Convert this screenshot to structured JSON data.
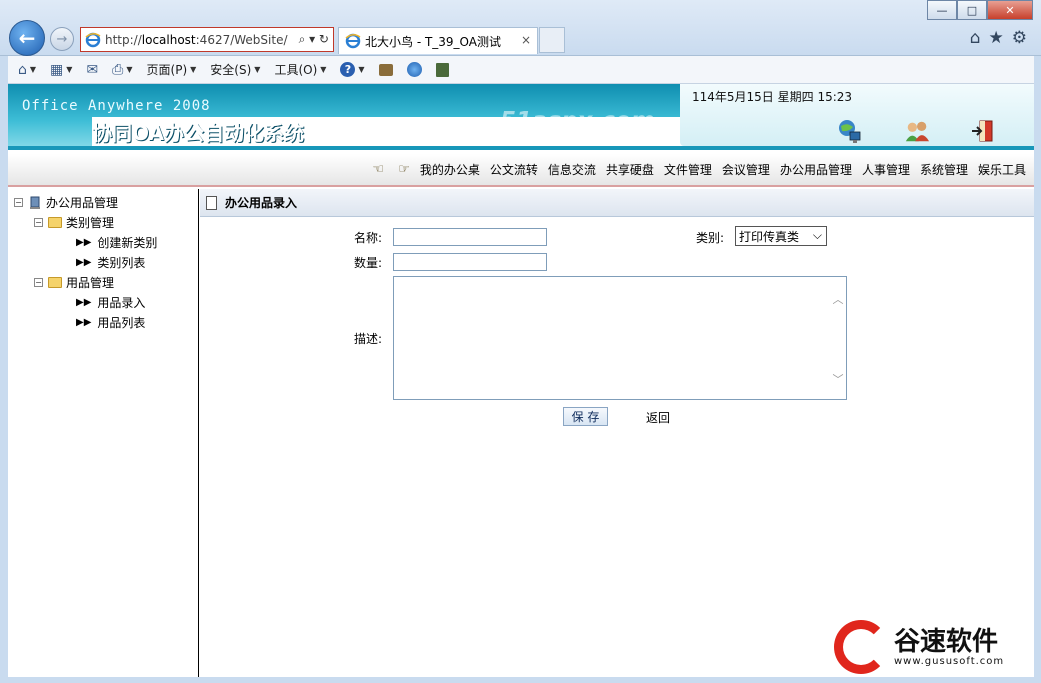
{
  "browser": {
    "address_prefix": "http://",
    "address_host": "localhost",
    "address_rest": ":4627/WebSite/",
    "address_tools": "⌕ ▾ ↻",
    "tab_title": "北大小鸟 - T_39_OA测试",
    "tab_close": "×",
    "back_glyph": "←",
    "forward_glyph": "→",
    "window_buttons": {
      "minimize": "—",
      "maximize": "□",
      "close": "✕"
    },
    "right_icons": {
      "home": "⌂",
      "favorites": "★",
      "tools": "⚙"
    }
  },
  "command_bar": {
    "home_glyph": "⌂",
    "feeds_glyph": "▦",
    "mail_glyph": "✉",
    "print_glyph": "⎙",
    "page_menu": "页面(P)",
    "safety_menu": "安全(S)",
    "tools_menu": "工具(O)",
    "help_glyph": "?",
    "arrow": "▼"
  },
  "banner": {
    "subtitle": "Office Anywhere 2008",
    "title": "协同OA办公自动化系统",
    "watermark": "51aspx.com",
    "datetime": "114年5月15日 星期四 15:23"
  },
  "nav": {
    "items": [
      "我的办公桌",
      "公文流转",
      "信息交流",
      "共享硬盘",
      "文件管理",
      "会议管理",
      "办公用品管理",
      "人事管理",
      "系统管理",
      "娱乐工具"
    ]
  },
  "tree": {
    "root": "办公用品管理",
    "groups": [
      {
        "label": "类别管理",
        "children": [
          "创建新类别",
          "类别列表"
        ]
      },
      {
        "label": "用品管理",
        "children": [
          "用品录入",
          "用品列表"
        ]
      }
    ]
  },
  "form": {
    "header": "办公用品录入",
    "name_label": "名称:",
    "category_label": "类别:",
    "category_value": "打印传真类",
    "quantity_label": "数量:",
    "description_label": "描述:",
    "save_button": "保 存",
    "back_link": "返回"
  },
  "brand": {
    "name": "谷速软件",
    "url": "www.gususoft.com"
  }
}
